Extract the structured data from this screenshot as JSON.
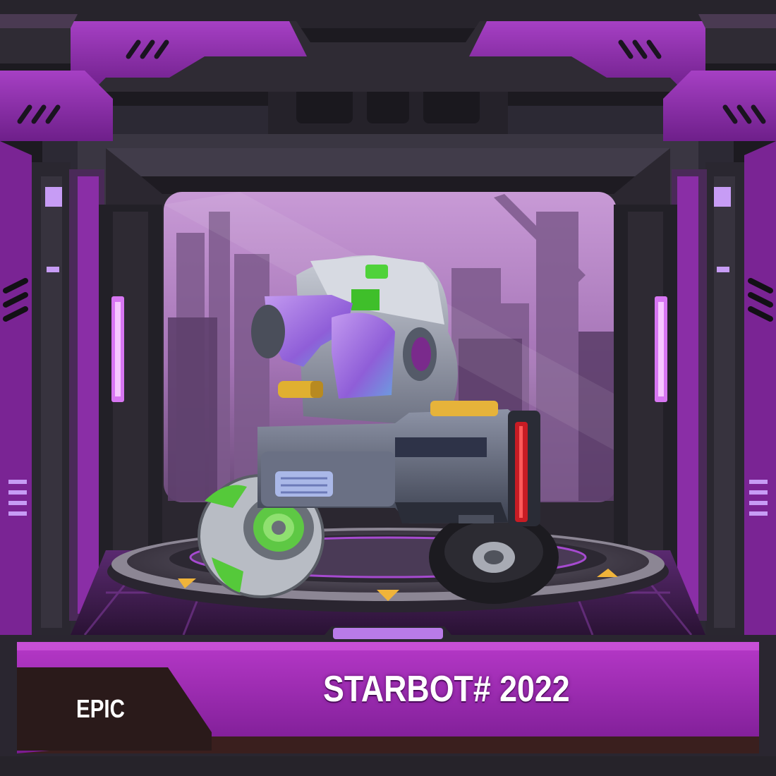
{
  "card": {
    "name": "STARBOT# 2022",
    "rarity": "EPIC"
  },
  "colors": {
    "frame_purple": "#8a2aa8",
    "frame_dark": "#2a2630",
    "sky_purple": "#b57fc4",
    "robot_purple": "#a06be0",
    "robot_green": "#3fbf2a",
    "accent_red": "#c81c24",
    "accent_gold": "#e6b33a",
    "rarity_bg": "#2a1a1a"
  },
  "icons": [
    "vent-slits-icon",
    "light-bar-icon",
    "arrow-marker-icon"
  ]
}
